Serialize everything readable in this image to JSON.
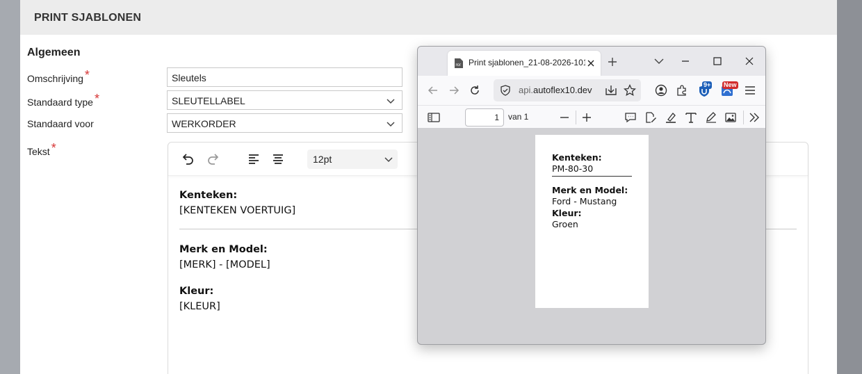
{
  "app": {
    "title": "PRINT SJABLONEN",
    "section_title": "Algemeen",
    "fields": {
      "omschrijving": {
        "label": "Omschrijving",
        "value": "Sleutels"
      },
      "standaard_type": {
        "label": "Standaard type",
        "value": "SLEUTELLABEL"
      },
      "standaard_voor": {
        "label": "Standaard voor",
        "value": "WERKORDER"
      },
      "tekst": {
        "label": "Tekst"
      }
    },
    "required_marker": "*",
    "editor": {
      "toolbar": {
        "font_size": "12pt"
      },
      "content": {
        "kenteken_label": "Kenteken:",
        "kenteken_value": "[KENTEKEN VOERTUIG]",
        "merk_label": "Merk en Model:",
        "merk_value": "[MERK] - [MODEL]",
        "kleur_label": "Kleur:",
        "kleur_value": "[KLEUR]"
      }
    }
  },
  "viewer": {
    "tab_title": "Print sjablonen_21-08-2026-101",
    "url_prefix": "api.",
    "url_domain": "autoflex10.dev",
    "page_current": "1",
    "page_of": "van 1",
    "badges": {
      "extension_count": "9+",
      "new_label": "New"
    },
    "pdf": {
      "kenteken_label": "Kenteken:",
      "kenteken_value": "PM-80-30",
      "merk_label": "Merk en Model:",
      "merk_value": "Ford - Mustang",
      "kleur_label": "Kleur:",
      "kleur_value": "Groen"
    }
  },
  "colors": {
    "required": "#d63535",
    "header_bg": "#ececec",
    "badge_blue": "#1d5fb8",
    "badge_red": "#d22c2c"
  }
}
